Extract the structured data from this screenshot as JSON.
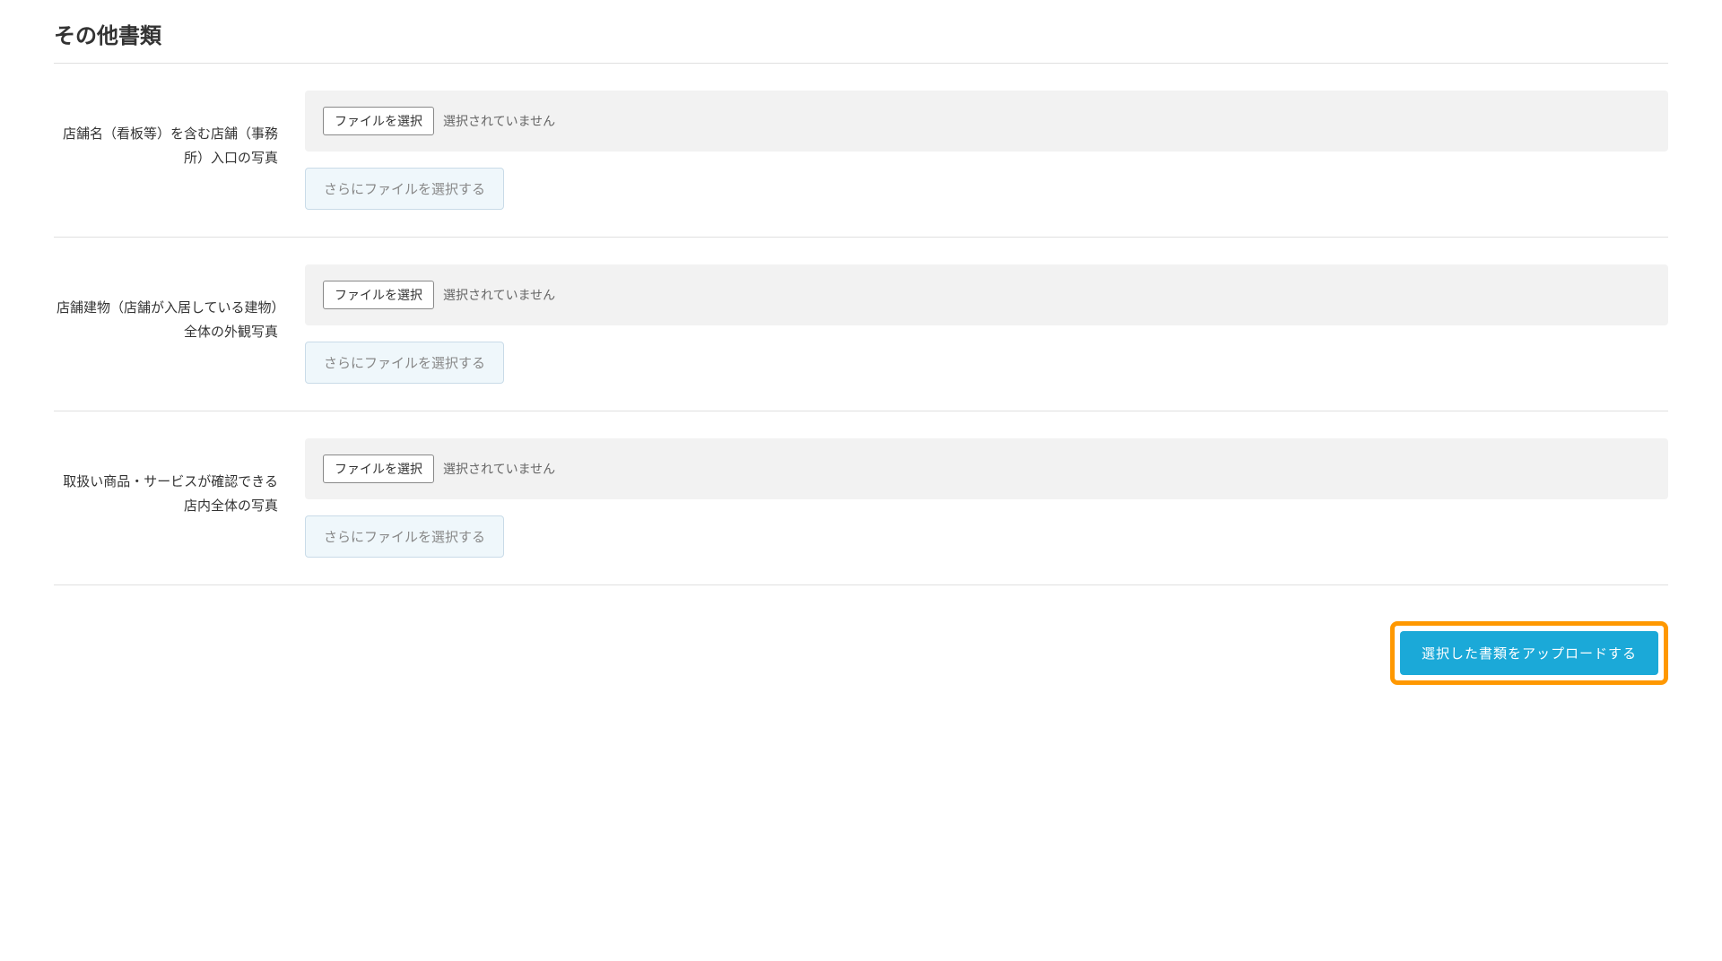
{
  "section": {
    "title": "その他書類"
  },
  "rows": [
    {
      "label": "店舗名（看板等）を含む店舗（事務所）入口の写真",
      "file_select_button": "ファイルを選択",
      "file_status": "選択されていません",
      "more_button": "さらにファイルを選択する"
    },
    {
      "label": "店舗建物（店舗が入居している建物）全体の外観写真",
      "file_select_button": "ファイルを選択",
      "file_status": "選択されていません",
      "more_button": "さらにファイルを選択する"
    },
    {
      "label": "取扱い商品・サービスが確認できる店内全体の写真",
      "file_select_button": "ファイルを選択",
      "file_status": "選択されていません",
      "more_button": "さらにファイルを選択する"
    }
  ],
  "footer": {
    "upload_button": "選択した書類をアップロードする"
  }
}
